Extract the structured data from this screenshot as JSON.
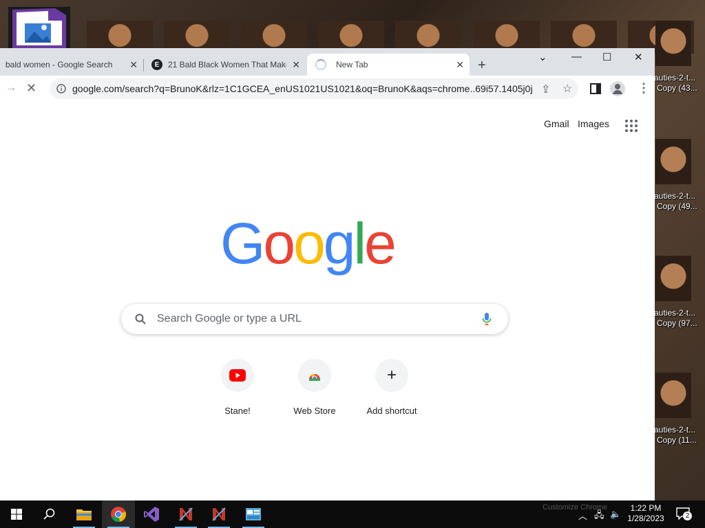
{
  "desktop": {
    "files": [
      {
        "label_line1": "auties-2-t...",
        "label_line2": "Copy (43..."
      },
      {
        "label_line1": "auties-2-t...",
        "label_line2": "Copy (49..."
      },
      {
        "label_line1": "auties-2-t...",
        "label_line2": "Copy (97..."
      },
      {
        "label_line1": "auties-2-t...",
        "label_line2": "Copy (11..."
      }
    ]
  },
  "browser": {
    "tabs": [
      {
        "title": "bald women - Google Search",
        "favicon": "google-icon"
      },
      {
        "title": "21 Bald Black Women That Make",
        "favicon": "e-icon"
      },
      {
        "title": "New Tab",
        "favicon": "loading-spinner"
      }
    ],
    "url": "google.com/search?q=BrunoK&rlz=1C1GCEA_enUS1021US1021&oq=BrunoK&aqs=chrome..69i57.1405j0j...",
    "newtab": {
      "links": {
        "gmail": "Gmail",
        "images": "Images"
      },
      "logo": "Google",
      "logo_colors": [
        "#4285F4",
        "#EA4335",
        "#FBBC05",
        "#4285F4",
        "#34A853",
        "#EA4335"
      ],
      "search_placeholder": "Search Google or type a URL",
      "shortcuts": [
        {
          "label": "Stane!",
          "icon": "youtube-icon"
        },
        {
          "label": "Web Store",
          "icon": "chrome-web-store-icon"
        },
        {
          "label": "Add shortcut",
          "icon": "plus-icon"
        }
      ]
    }
  },
  "taskbar": {
    "time": "1:22 PM",
    "date": "1/28/2023",
    "notification_count": "2",
    "ghost_text": "Customize Chrome"
  }
}
